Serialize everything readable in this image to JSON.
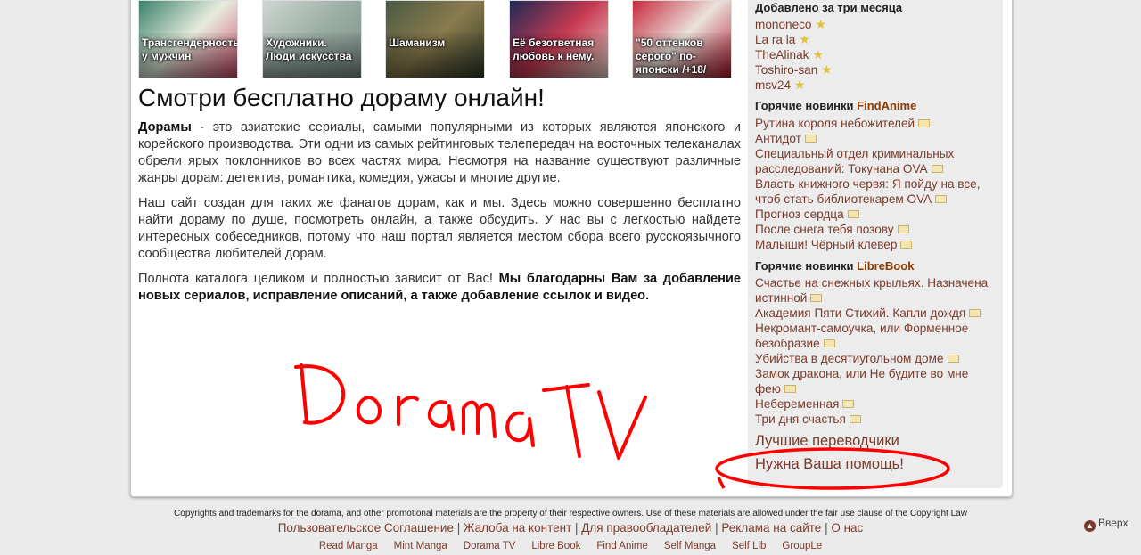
{
  "tiles": [
    {
      "caption": "Трансгендерность у мужчин",
      "colors": [
        "#3a7f6a",
        "#e7eddf",
        "#d04c6b"
      ]
    },
    {
      "caption": "Художники. Люди искусства",
      "colors": [
        "#cfd6d1",
        "#9aaea5",
        "#7d8d86"
      ]
    },
    {
      "caption": "Шаманизм",
      "colors": [
        "#4a5a44",
        "#8a7b4c",
        "#2f3b2a"
      ]
    },
    {
      "caption": "Её безответная любовь к нему.",
      "colors": [
        "#1c2a55",
        "#c83a52",
        "#e9d9d0"
      ]
    },
    {
      "caption": "\"50 оттенков серого\" по-японски /+18/",
      "colors": [
        "#c62a3b",
        "#eae2dc",
        "#b3162a"
      ]
    }
  ],
  "main": {
    "title": "Смотри бесплатно дораму онлайн!",
    "p1_bold": "Дорамы",
    "p1_text": " - это азиатские сериалы, самыми популярными из которых являются японского и корейского производства. Эти одни из самых рейтинговых телепередач на восточных телеканалах обрели ярых поклонников во всех частях мира. Несмотря на название существуют различные жанры дорам: детектив, романтика, комедия, ужасы и многие другие.",
    "p2_text": "Наш сайт создан для таких же фанатов дорам, как и мы. Здесь можно совершенно бесплатно найти дораму по душе, посмотреть онлайн, а также обсудить. У нас вы с легкостью найдете интересных собеседников, потому что наш портал является местом сбора всего русскоязычного сообщества любителей дорам.",
    "p3_text": "Полнота каталога целиком и полностью зависит от Вас! ",
    "p3_bold": "Мы благодарны Вам за добавление новых сериалов, исправление описаний, а также добавление ссылок и видео."
  },
  "sidebar": {
    "added_heading": "Добавлено за три месяца",
    "users": [
      "mononeco",
      "La ra la",
      "TheAlinak",
      "Toshiro-san",
      "msv24"
    ],
    "findanime_heading_prefix": "Горячие новинки ",
    "findanime_brand": "FindAnime",
    "findanime_items": [
      "Рутина короля небожителей",
      "Антидот",
      "Специальный отдел криминальных расследований: Токунана OVA",
      "Власть книжного червя: Я пойду на все, чтоб стать библиотекарем OVA",
      "Прогноз сердца",
      "После снега тебя позову",
      "Малыши! Чёрный клевер"
    ],
    "librebook_heading_prefix": "Горячие новинки ",
    "librebook_brand": "LibreBook",
    "librebook_items": [
      "Счастье на снежных крыльях. Назначена истинной",
      "Академия Пяти Стихий. Капли дождя",
      "Некромант-самоучка, или Форменное безобразие",
      "Убийства в десятиугольном доме",
      "Замок дракона, или Не будите во мне фею",
      "Небеременная",
      "Три дня счастья"
    ],
    "best_translators": "Лучшие переводчики",
    "need_help": "Нужна Ваша помощь!"
  },
  "annotation": {
    "scribble_text": "DoramaTV",
    "color": "#ff0000"
  },
  "footer": {
    "copyright": "Copyrights and trademarks for the dorama, and other promotional materials are the property of their respective owners. Use of these materials are allowed under the fair use clause of the Copyright Law",
    "links": [
      "Пользовательское Соглашение",
      "Жалоба на контент",
      "Для правообладателей",
      "Реклама на сайте",
      "О нас"
    ],
    "sites": [
      "Read Manga",
      "Mint Manga",
      "Dorama TV",
      "Libre Book",
      "Find Anime",
      "Self Manga",
      "Self Lib",
      "GroupLe"
    ],
    "to_top": "Вверх"
  }
}
